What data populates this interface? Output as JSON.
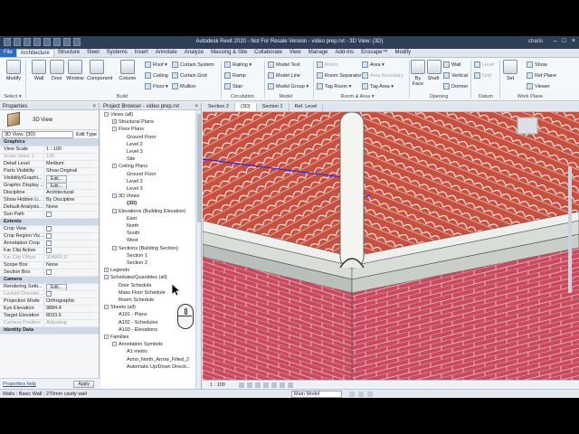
{
  "titlebar": {
    "title": "Autodesk Revit 2020 - Not For Resale Version - video prep.rvt - 3D View: {3D}",
    "user": "charis"
  },
  "tabs": [
    "File",
    "Architecture",
    "Structure",
    "Steel",
    "Systems",
    "Insert",
    "Annotate",
    "Analyze",
    "Massing & Site",
    "Collaborate",
    "View",
    "Manage",
    "Add-Ins",
    "Enscape™",
    "Modify"
  ],
  "ribbon": {
    "select": {
      "modify": "Modify",
      "select": "Select ▾"
    },
    "build_large": [
      "Wall",
      "Door",
      "Window",
      "Component",
      "Column"
    ],
    "build_small": [
      "Roof ▾",
      "Curtain System",
      "Ceiling",
      "Curtain Grid",
      "Floor ▾",
      "Mullion"
    ],
    "circulation": [
      "Railing ▾",
      "Ramp",
      "Stair"
    ],
    "model": [
      "Model Text",
      "Model Line",
      "Model Group ▾"
    ],
    "room_area": [
      "Room",
      "Room Separator",
      "Tag Room ▾",
      "Area ▾",
      "Area Boundary",
      "Tag Area ▾"
    ],
    "opening": [
      "By Face",
      "Shaft",
      "Wall",
      "Vertical",
      "Dormer"
    ],
    "datum": [
      "Level",
      "Grid"
    ],
    "work_plane": [
      "Set",
      "Show",
      "Ref Plane",
      "Viewer"
    ],
    "panel_labels": {
      "select": "Select",
      "build": "Build",
      "circulation": "Circulation",
      "model": "Model",
      "room_area": "Room & Area ▾",
      "opening": "Opening",
      "datum": "Datum",
      "work_plane": "Work Plane"
    }
  },
  "properties": {
    "header": "Properties",
    "type_name": "3D View",
    "view_selector": "3D View: {3D}",
    "edit_type": "Edit Type",
    "sections": [
      {
        "label": "Graphics",
        "cat": true
      },
      {
        "k": "View Scale",
        "v": "1 : 100"
      },
      {
        "k": "Scale Value    1:",
        "v": "100",
        "dim": true
      },
      {
        "k": "Detail Level",
        "v": "Medium"
      },
      {
        "k": "Parts Visibility",
        "v": "Show Original"
      },
      {
        "k": "Visibility/Graphi...",
        "v": "Edit..."
      },
      {
        "k": "Graphic Display ...",
        "v": "Edit..."
      },
      {
        "k": "Discipline",
        "v": "Architectural"
      },
      {
        "k": "Show Hidden Li...",
        "v": "By Discipline"
      },
      {
        "k": "Default Analysis...",
        "v": "None"
      },
      {
        "k": "Sun Path",
        "v": ""
      },
      {
        "label": "Extents",
        "cat": true
      },
      {
        "k": "Crop View",
        "v": ""
      },
      {
        "k": "Crop Region Vis...",
        "v": ""
      },
      {
        "k": "Annotation Crop",
        "v": ""
      },
      {
        "k": "Far Clip Active",
        "v": ""
      },
      {
        "k": "Far Clip Offset",
        "v": "304800.0",
        "dim": true
      },
      {
        "k": "Scope Box",
        "v": "None"
      },
      {
        "k": "Section Box",
        "v": ""
      },
      {
        "label": "Camera",
        "cat": true
      },
      {
        "k": "Rendering Setti...",
        "v": "Edit..."
      },
      {
        "k": "Locked Orientat...",
        "v": "",
        "dim": true
      },
      {
        "k": "Projection Mode",
        "v": "Orthographic"
      },
      {
        "k": "Eye Elevation",
        "v": "9884.4"
      },
      {
        "k": "Target Elevation",
        "v": "8033.6"
      },
      {
        "k": "Camera Position",
        "v": "Adjusting",
        "dim": true
      },
      {
        "label": "Identity Data",
        "cat": true
      }
    ],
    "help": "Properties help",
    "apply": "Apply"
  },
  "browser": {
    "header": "Project Browser - video prep.rvt",
    "nodes": [
      {
        "t": "Views (all)",
        "lvl": 0,
        "tg": "−"
      },
      {
        "t": "Structural Plans",
        "lvl": 1,
        "tg": "+"
      },
      {
        "t": "Floor Plans",
        "lvl": 1,
        "tg": "−"
      },
      {
        "t": "Ground Floor",
        "lvl": 2
      },
      {
        "t": "Level 2",
        "lvl": 2
      },
      {
        "t": "Level 3",
        "lvl": 2
      },
      {
        "t": "Site",
        "lvl": 2
      },
      {
        "t": "Ceiling Plans",
        "lvl": 1,
        "tg": "−"
      },
      {
        "t": "Ground Floor",
        "lvl": 2
      },
      {
        "t": "Level 2",
        "lvl": 2
      },
      {
        "t": "Level 3",
        "lvl": 2
      },
      {
        "t": "3D Views",
        "lvl": 1,
        "tg": "−"
      },
      {
        "t": "{3D}",
        "lvl": 2,
        "bold": true
      },
      {
        "t": "Elevations (Building Elevation)",
        "lvl": 1,
        "tg": "−"
      },
      {
        "t": "East",
        "lvl": 2
      },
      {
        "t": "North",
        "lvl": 2
      },
      {
        "t": "South",
        "lvl": 2
      },
      {
        "t": "West",
        "lvl": 2
      },
      {
        "t": "Sections (Building Section)",
        "lvl": 1,
        "tg": "−"
      },
      {
        "t": "Section 1",
        "lvl": 2
      },
      {
        "t": "Section 2",
        "lvl": 2
      },
      {
        "t": "Legends",
        "lvl": 0,
        "tg": "+"
      },
      {
        "t": "Schedules/Quantities (all)",
        "lvl": 0,
        "tg": "−"
      },
      {
        "t": "Door Schedule",
        "lvl": 1
      },
      {
        "t": "Mass Floor Schedule",
        "lvl": 1
      },
      {
        "t": "Room Schedule",
        "lvl": 1
      },
      {
        "t": "Sheets (all)",
        "lvl": 0,
        "tg": "−"
      },
      {
        "t": "A101 - Plans",
        "lvl": 1
      },
      {
        "t": "A102 - Schedules",
        "lvl": 1
      },
      {
        "t": "A103 - Elevations",
        "lvl": 1
      },
      {
        "t": "Families",
        "lvl": 0,
        "tg": "−"
      },
      {
        "t": "Annotation Symbols",
        "lvl": 1,
        "tg": "−"
      },
      {
        "t": "A1 metric",
        "lvl": 2
      },
      {
        "t": "Anno_North_Arrow_Filled_2",
        "lvl": 2
      },
      {
        "t": "Automatic Up/Down Directi...",
        "lvl": 2
      }
    ]
  },
  "view_tabs": [
    "Section 2",
    "{3D}",
    "Section 1",
    "Ref. Level"
  ],
  "view_control": {
    "scale": "1 : 100"
  },
  "status": {
    "message": "Walls : Basic Wall : 270mm cavity wall",
    "model": "Main Model"
  },
  "colors": {
    "roof": "#c8503f",
    "brick": "#c94a5f",
    "fascia": "#d9ddd8",
    "accent": "#2b6cc4"
  }
}
